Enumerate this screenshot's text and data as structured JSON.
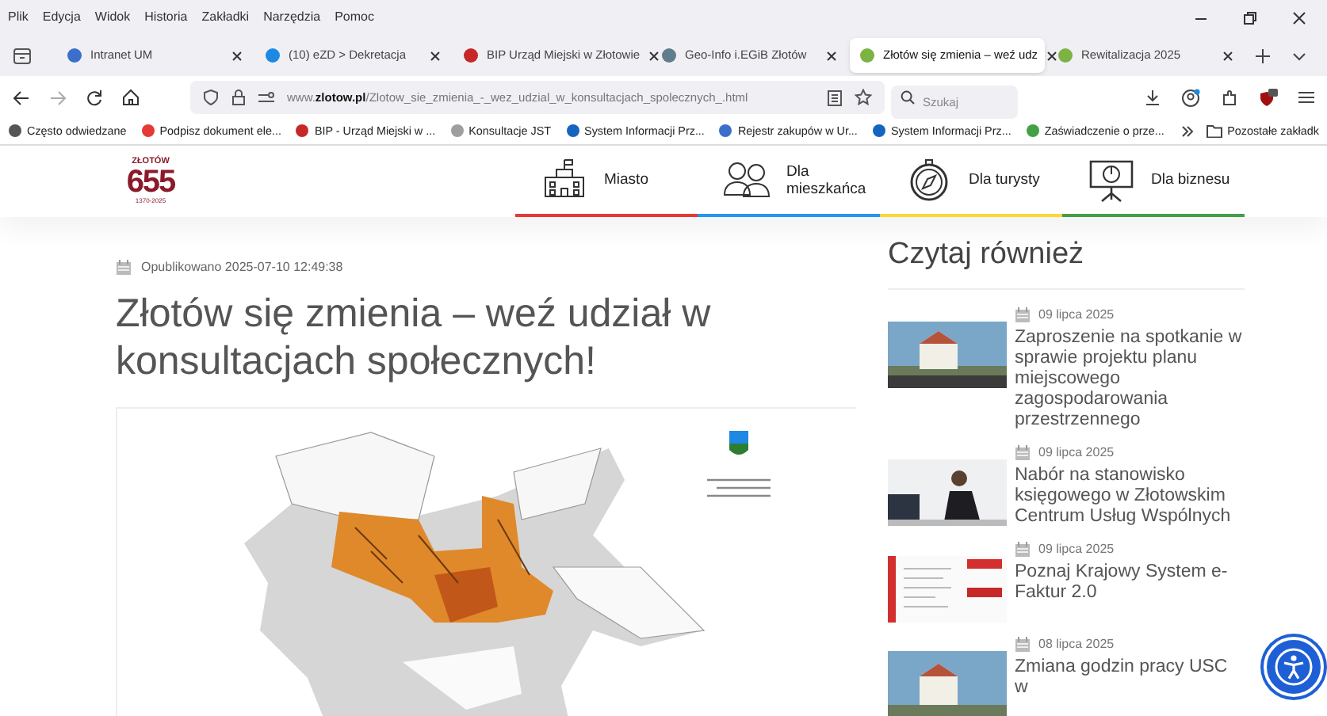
{
  "menu_bar": [
    "Plik",
    "Edycja",
    "Widok",
    "Historia",
    "Zakładki",
    "Narzędzia",
    "Pomoc"
  ],
  "tabs": [
    {
      "title": "Intranet UM",
      "selected": false
    },
    {
      "title": "(10) eZD > Dekretacja",
      "selected": false
    },
    {
      "title": "BIP Urząd Miejski w Złotowie",
      "selected": false
    },
    {
      "title": "Geo-Info i.EGiB Złotów",
      "selected": false
    },
    {
      "title": "Złotów się zmienia – weź udz",
      "selected": true
    },
    {
      "title": "Rewitalizacja 2025",
      "selected": false
    }
  ],
  "url": "www.**zlotow.pl**/Zlotow_sie_zmienia_-_wez_udzial_w_konsultacjach_spolecznych_.html",
  "search": {
    "placeholder": "Szukaj"
  },
  "bookmarks": [
    "Często odwiedzane",
    "Podpisz dokument ele...",
    "BIP - Urząd Miejski w ...",
    "Konsultacje JST",
    "System Informacji Prz...",
    "Rejestr zakupów w Ur...",
    "System Informacji Prz...",
    "Zaświadczenie o prze..."
  ],
  "other_bookmarks": "Pozostałe zakładk",
  "site_header": {
    "logo": {
      "name": "ZŁOTÓW",
      "number": "655",
      "years": "1370-2025"
    },
    "nav": [
      {
        "label": "Miasto",
        "color": "#e53935"
      },
      {
        "label": "Dla mieszkańca",
        "color": "#2196f3"
      },
      {
        "label": "Dla turysty",
        "color": "#fdd835"
      },
      {
        "label": "Dla biznesu",
        "color": "#43a047"
      }
    ]
  },
  "article": {
    "published": "Opublikowano 2025-07-10 12:49:38",
    "title": "Złotów się zmienia – weź udział w konsultacjach społecznych!"
  },
  "sidebar": {
    "heading": "Czytaj również",
    "items": [
      {
        "date": "09 lipca 2025",
        "title": "Zaproszenie na spotkanie w sprawie projektu planu miejscowego zagospodarowania przestrzennego"
      },
      {
        "date": "09 lipca 2025",
        "title": "Nabór na stanowisko księgowego w Złotowskim Centrum Usług Wspólnych"
      },
      {
        "date": "09 lipca 2025",
        "title": "Poznaj Krajowy System e-Faktur 2.0"
      },
      {
        "date": "08 lipca 2025",
        "title": "Zmiana godzin pracy USC w"
      }
    ]
  }
}
